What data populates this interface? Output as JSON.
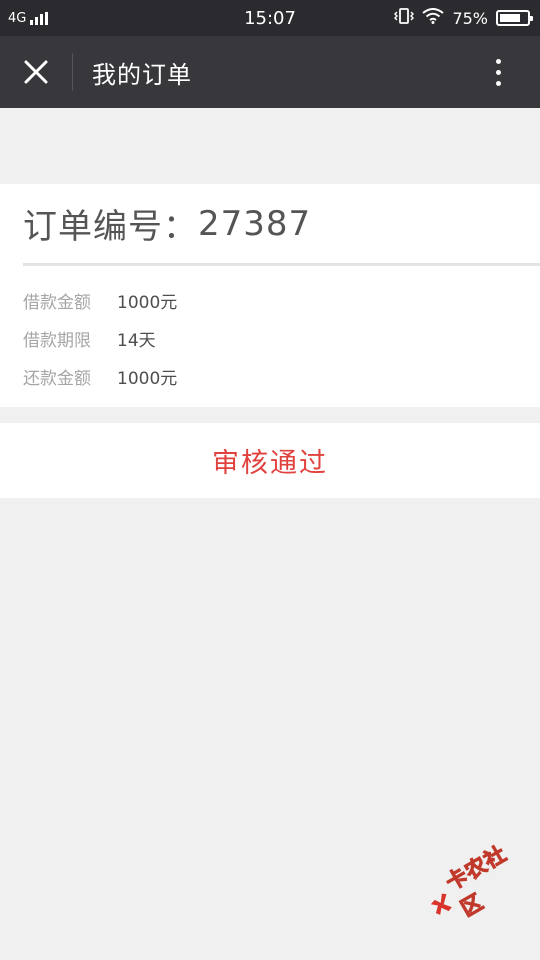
{
  "status_bar": {
    "network": "4G",
    "time": "15:07",
    "battery": "75%",
    "battery_level": 0.75
  },
  "nav": {
    "title": "我的订单"
  },
  "order": {
    "number_label": "订单编号：",
    "number": "27387",
    "details": [
      {
        "label": "借款金额",
        "value": "1000元"
      },
      {
        "label": "借款期限",
        "value": "14天"
      },
      {
        "label": "还款金额",
        "value": "1000元"
      }
    ]
  },
  "status": {
    "text": "审核通过",
    "color": "#e0433e"
  },
  "watermark": {
    "text": "卡农社区"
  }
}
